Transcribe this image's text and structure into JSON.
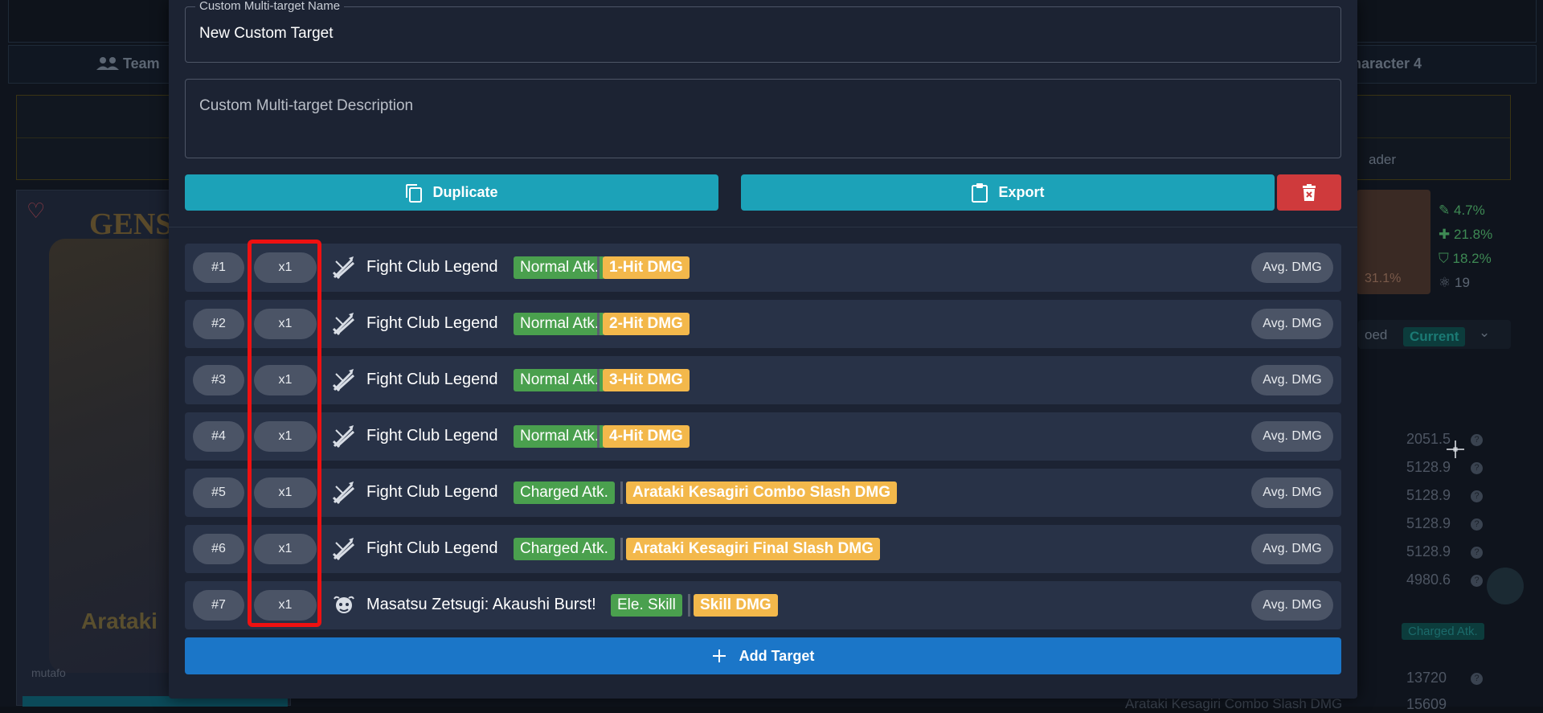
{
  "background": {
    "tabs": {
      "team": "Team",
      "character4": "haracter 4"
    },
    "panel": {
      "loader": "ader"
    },
    "card": {
      "logo": "GENSHIN",
      "name": "Arataki",
      "watermark": "mutafo"
    },
    "stats": [
      {
        "icon": "sword-icon",
        "value": "4.7%",
        "color": "#3e8a54"
      },
      {
        "icon": "plus-icon",
        "value": "21.8%",
        "color": "#3e8a54"
      },
      {
        "icon": "shield-icon",
        "value": "18.2%",
        "color": "#3e8a54"
      },
      {
        "icon": "atom-icon",
        "value": "19",
        "color": "#5c6673"
      }
    ],
    "portrait_value": "31.1%",
    "current_label": "Current",
    "dropdown_prefix": "oed",
    "values": [
      "2051.5",
      "5128.9",
      "5128.9",
      "5128.9",
      "5128.9",
      "4980.6"
    ],
    "charged_badge": "Charged Atk.",
    "bottom_value": "13720",
    "bottom_value2": "15609",
    "bottom_text": "Arataki Kesagiri Combo Slash DMG"
  },
  "modal": {
    "name_legend": "Custom Multi-target Name",
    "name_value": "New Custom Target",
    "description_placeholder": "Custom Multi-target Description",
    "duplicate_label": "Duplicate",
    "export_label": "Export",
    "add_target_label": "Add Target",
    "targets": [
      {
        "num": "#1",
        "mult": "x1",
        "icon": "fight-club-icon",
        "name": "Fight Club Legend",
        "type": "Normal Atk.",
        "hit": "1-Hit DMG",
        "avg": "Avg. DMG"
      },
      {
        "num": "#2",
        "mult": "x1",
        "icon": "fight-club-icon",
        "name": "Fight Club Legend",
        "type": "Normal Atk.",
        "hit": "2-Hit DMG",
        "avg": "Avg. DMG"
      },
      {
        "num": "#3",
        "mult": "x1",
        "icon": "fight-club-icon",
        "name": "Fight Club Legend",
        "type": "Normal Atk.",
        "hit": "3-Hit DMG",
        "avg": "Avg. DMG"
      },
      {
        "num": "#4",
        "mult": "x1",
        "icon": "fight-club-icon",
        "name": "Fight Club Legend",
        "type": "Normal Atk.",
        "hit": "4-Hit DMG",
        "avg": "Avg. DMG"
      },
      {
        "num": "#5",
        "mult": "x1",
        "icon": "fight-club-icon",
        "name": "Fight Club Legend",
        "type": "Charged Atk.",
        "hit": "Arataki Kesagiri Combo Slash DMG",
        "avg": "Avg. DMG"
      },
      {
        "num": "#6",
        "mult": "x1",
        "icon": "fight-club-icon",
        "name": "Fight Club Legend",
        "type": "Charged Atk.",
        "hit": "Arataki Kesagiri Final Slash DMG",
        "avg": "Avg. DMG"
      },
      {
        "num": "#7",
        "mult": "x1",
        "icon": "ushi-icon",
        "name": "Masatsu Zetsugi: Akaushi Burst!",
        "type": "Ele. Skill",
        "hit": "Skill DMG",
        "avg": "Avg. DMG"
      }
    ]
  },
  "colors": {
    "accent_teal": "#1ca2b8",
    "danger_red": "#cf3a3c",
    "primary_blue": "#1b76c8",
    "tag_green": "#4aa04e",
    "tag_yellow": "#f3b84b",
    "highlight": "#ee1111"
  }
}
